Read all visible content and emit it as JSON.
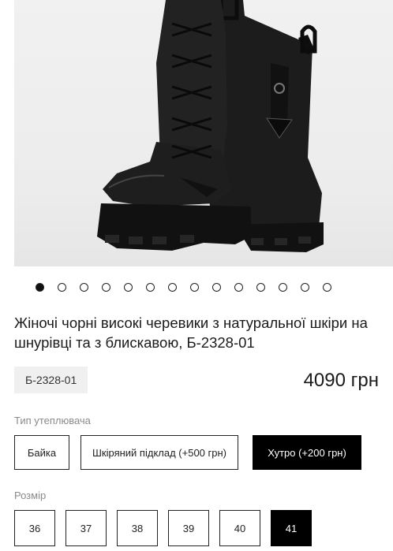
{
  "product": {
    "title": "Жіночі чорні високі черевики з натуральної шкіри на шнурівці та з блискавою, Б-2328-01",
    "sku": "Б-2328-01",
    "price": "4090 грн",
    "image_alt": "Black high lace-up leather boots"
  },
  "gallery": {
    "total_slides": 14,
    "active_index": 0
  },
  "insulation": {
    "label": "Тип утеплювача",
    "options": [
      {
        "label": "Байка",
        "selected": false
      },
      {
        "label": "Шкіряний підклад (+500 грн)",
        "selected": false
      },
      {
        "label": "Хутро (+200 грн)",
        "selected": true
      }
    ]
  },
  "size": {
    "label": "Розмір",
    "options": [
      {
        "label": "36",
        "selected": false
      },
      {
        "label": "37",
        "selected": false
      },
      {
        "label": "38",
        "selected": false
      },
      {
        "label": "39",
        "selected": false
      },
      {
        "label": "40",
        "selected": false
      },
      {
        "label": "41",
        "selected": true
      }
    ]
  },
  "colors": {
    "selected_bg": "#000000",
    "sku_bg": "#f0f0f0",
    "label_gray": "#8a8a8a"
  }
}
